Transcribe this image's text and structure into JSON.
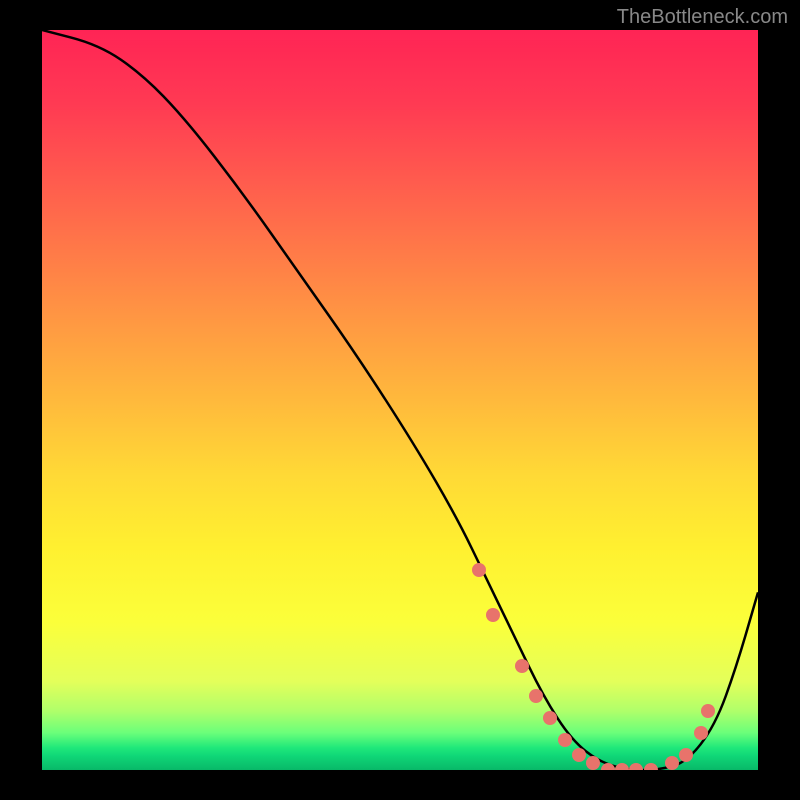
{
  "attribution": "TheBottleneck.com",
  "chart_data": {
    "type": "line",
    "title": "",
    "xlabel": "",
    "ylabel": "",
    "xlim": [
      0,
      100
    ],
    "ylim": [
      0,
      100
    ],
    "series": [
      {
        "name": "curve",
        "x": [
          0,
          8,
          14,
          20,
          28,
          36,
          44,
          52,
          58,
          62,
          66,
          70,
          74,
          78,
          82,
          86,
          90,
          94,
          97,
          100
        ],
        "y": [
          100,
          98,
          94,
          88,
          78,
          67,
          56,
          44,
          34,
          26,
          18,
          10,
          4,
          1,
          0,
          0,
          1,
          6,
          14,
          24
        ]
      }
    ],
    "markers": {
      "name": "highlight-dots",
      "x": [
        61,
        63,
        67,
        69,
        71,
        73,
        75,
        77,
        79,
        81,
        83,
        85,
        88,
        90,
        92,
        93
      ],
      "y": [
        27,
        21,
        14,
        10,
        7,
        4,
        2,
        1,
        0,
        0,
        0,
        0,
        1,
        2,
        5,
        8
      ]
    },
    "gradient_scale": {
      "top_color": "#ff2455",
      "bottom_color": "#08b868",
      "meaning": "heat-to-optimal"
    }
  }
}
